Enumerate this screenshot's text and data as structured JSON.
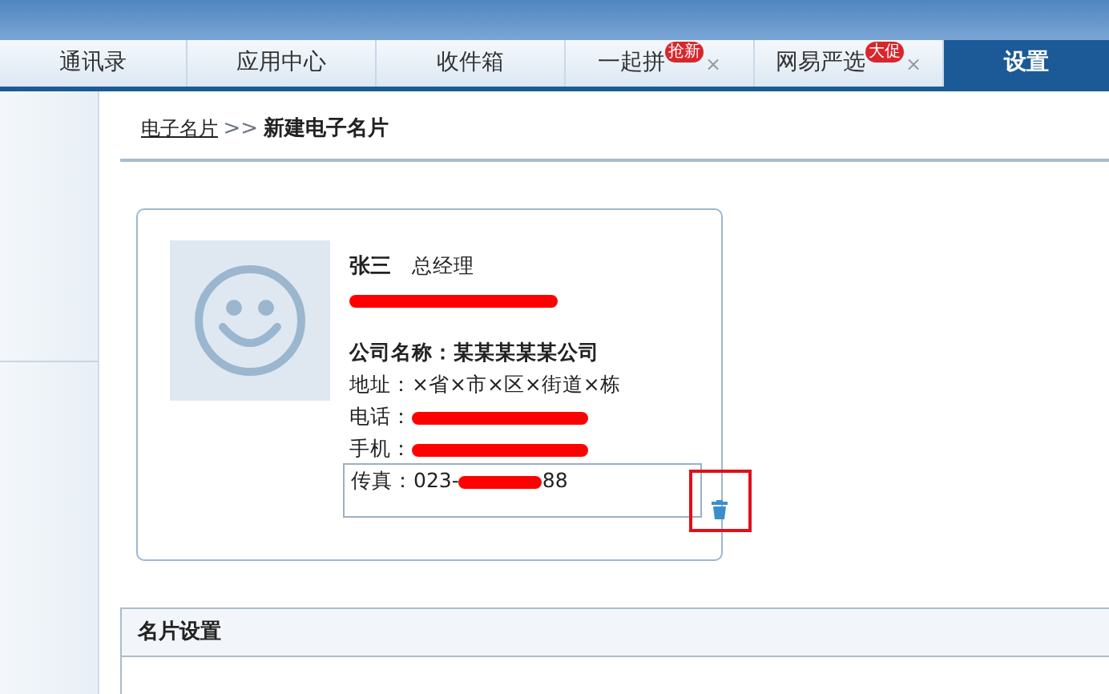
{
  "tabs": [
    {
      "label": "通讯录",
      "selected": false
    },
    {
      "label": "应用中心",
      "selected": false
    },
    {
      "label": "收件箱",
      "selected": false
    },
    {
      "label": "一起拼",
      "badge": "抢新",
      "close": "×",
      "selected": false
    },
    {
      "label": "网易严选",
      "badge": "大促",
      "close": "×",
      "selected": false
    },
    {
      "label": "设置",
      "selected": true
    }
  ],
  "breadcrumb": {
    "link": "电子名片",
    "separator": ">>",
    "current": "新建电子名片"
  },
  "card": {
    "name": "张三",
    "title": "总经理",
    "company": "公司名称：某某某某某公司",
    "address": "地址：×省×市×区×街道×栋",
    "phone_label": "电话：",
    "mobile_label": "手机：",
    "fax": {
      "label": "传真：",
      "prefix": "023-",
      "suffix": "88"
    }
  },
  "settings": {
    "title": "名片设置"
  }
}
